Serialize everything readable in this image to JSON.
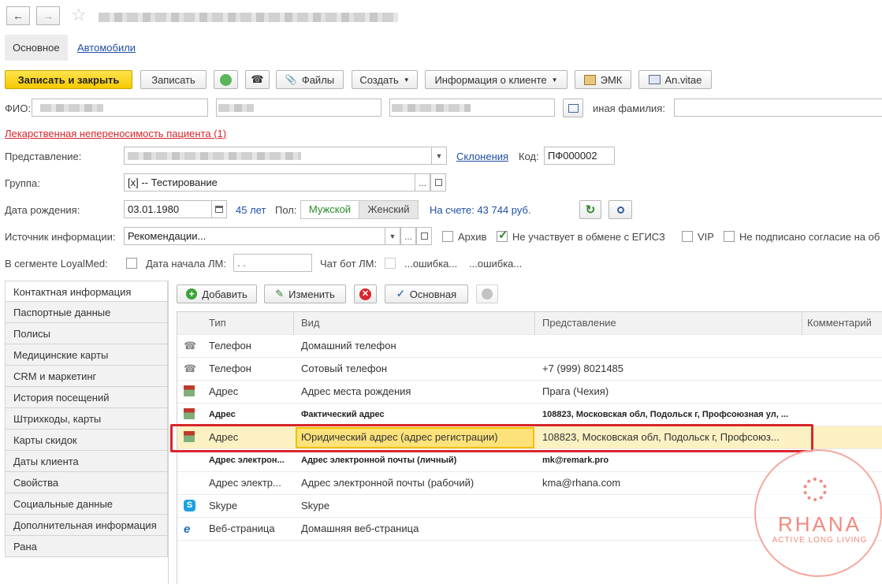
{
  "window": {
    "title_blurred": true
  },
  "top_tabs": [
    "Основное",
    "Автомобили"
  ],
  "toolbar": {
    "save_close": "Записать и закрыть",
    "save": "Записать",
    "files": "Файлы",
    "create": "Создать",
    "client_info": "Информация о клиенте",
    "emk": "ЭМК",
    "anvitae": "An.vitae"
  },
  "form": {
    "fio_label": "ФИО:",
    "other_surname_label": "иная фамилия:",
    "intolerance_link": "Лекарственная непереносимость пациента (1)",
    "representation_label": "Представление:",
    "declensions_link": "Склонения",
    "code_label": "Код:",
    "code_value": "ПФ000002",
    "group_label": "Группа:",
    "group_value": "[x] -- Тестирование",
    "birth_label": "Дата рождения:",
    "birth_value": "03.01.1980",
    "age": "45 лет",
    "sex_label": "Пол:",
    "sex_male": "Мужской",
    "sex_female": "Женский",
    "balance": "На счете: 43 744 руб.",
    "source_label": "Источник информации:",
    "source_value": "Рекомендации...",
    "archive_label": "Архив",
    "egisz_label": "Не участвует в обмене с ЕГИСЗ",
    "vip_label": "VIP",
    "consent_label": "Не подписано согласие на об",
    "segment_label": "В сегменте LoyalMed:",
    "lm_start_label": "Дата начала ЛМ:",
    "lm_start_value": " .  .",
    "chatbot_label": "Чат бот ЛМ:",
    "error1": "...ошибка...",
    "error2": "...ошибка..."
  },
  "sidebar": {
    "items": [
      "Контактная информация",
      "Паспортные данные",
      "Полисы",
      "Медицинские карты",
      "CRM и маркетинг",
      "История посещений",
      "Штрихкоды, карты",
      "Карты скидок",
      "Даты клиента",
      "Свойства",
      "Социальные данные",
      "Дополнительная информация",
      "Рана"
    ]
  },
  "grid_toolbar": {
    "add": "Добавить",
    "edit": "Изменить",
    "main": "Основная"
  },
  "table": {
    "columns": [
      "Тип",
      "Вид",
      "Представление",
      "Комментарий"
    ],
    "rows": [
      {
        "icon": "phone-icon",
        "type": "Телефон",
        "kind": "Домашний телефон",
        "repr": ""
      },
      {
        "icon": "phone-icon",
        "type": "Телефон",
        "kind": "Сотовый телефон",
        "repr": "+7 (999) 8021485"
      },
      {
        "icon": "house-icon",
        "type": "Адрес",
        "kind": "Адрес места рождения",
        "repr": "Прага (Чехия)"
      },
      {
        "icon": "house-icon",
        "type": "Адрес",
        "kind": "Фактический адрес",
        "repr": "108823, Московская обл, Подольск г, Профсоюзная ул, ..."
      },
      {
        "icon": "house-icon",
        "type": "Адрес",
        "kind": "Юридический адрес (адрес регистрации)",
        "repr": "108823, Московская обл, Подольск г, Профсоюз..."
      },
      {
        "icon": "",
        "type": "Адрес электрон...",
        "kind": "Адрес электронной почты (личный)",
        "repr": "mk@remark.pro"
      },
      {
        "icon": "",
        "type": "Адрес электр...",
        "kind": "Адрес электронной почты (рабочий)",
        "repr": "kma@rhana.com"
      },
      {
        "icon": "skype-icon",
        "type": "Skype",
        "kind": "Skype",
        "repr": ""
      },
      {
        "icon": "ie-icon",
        "type": "Веб-страница",
        "kind": "Домашняя веб-страница",
        "repr": ""
      }
    ]
  },
  "watermark": {
    "brand": "RHANA",
    "tagline": "ACTIVE LONG LIVING"
  },
  "colors": {
    "accent_yellow": "#f5c900",
    "link_blue": "#1f4fa5",
    "error_red": "#d8262b",
    "highlight_frame": "#d8262b",
    "selected_row": "#fbf1c2",
    "watermark": "#f08a7e"
  }
}
